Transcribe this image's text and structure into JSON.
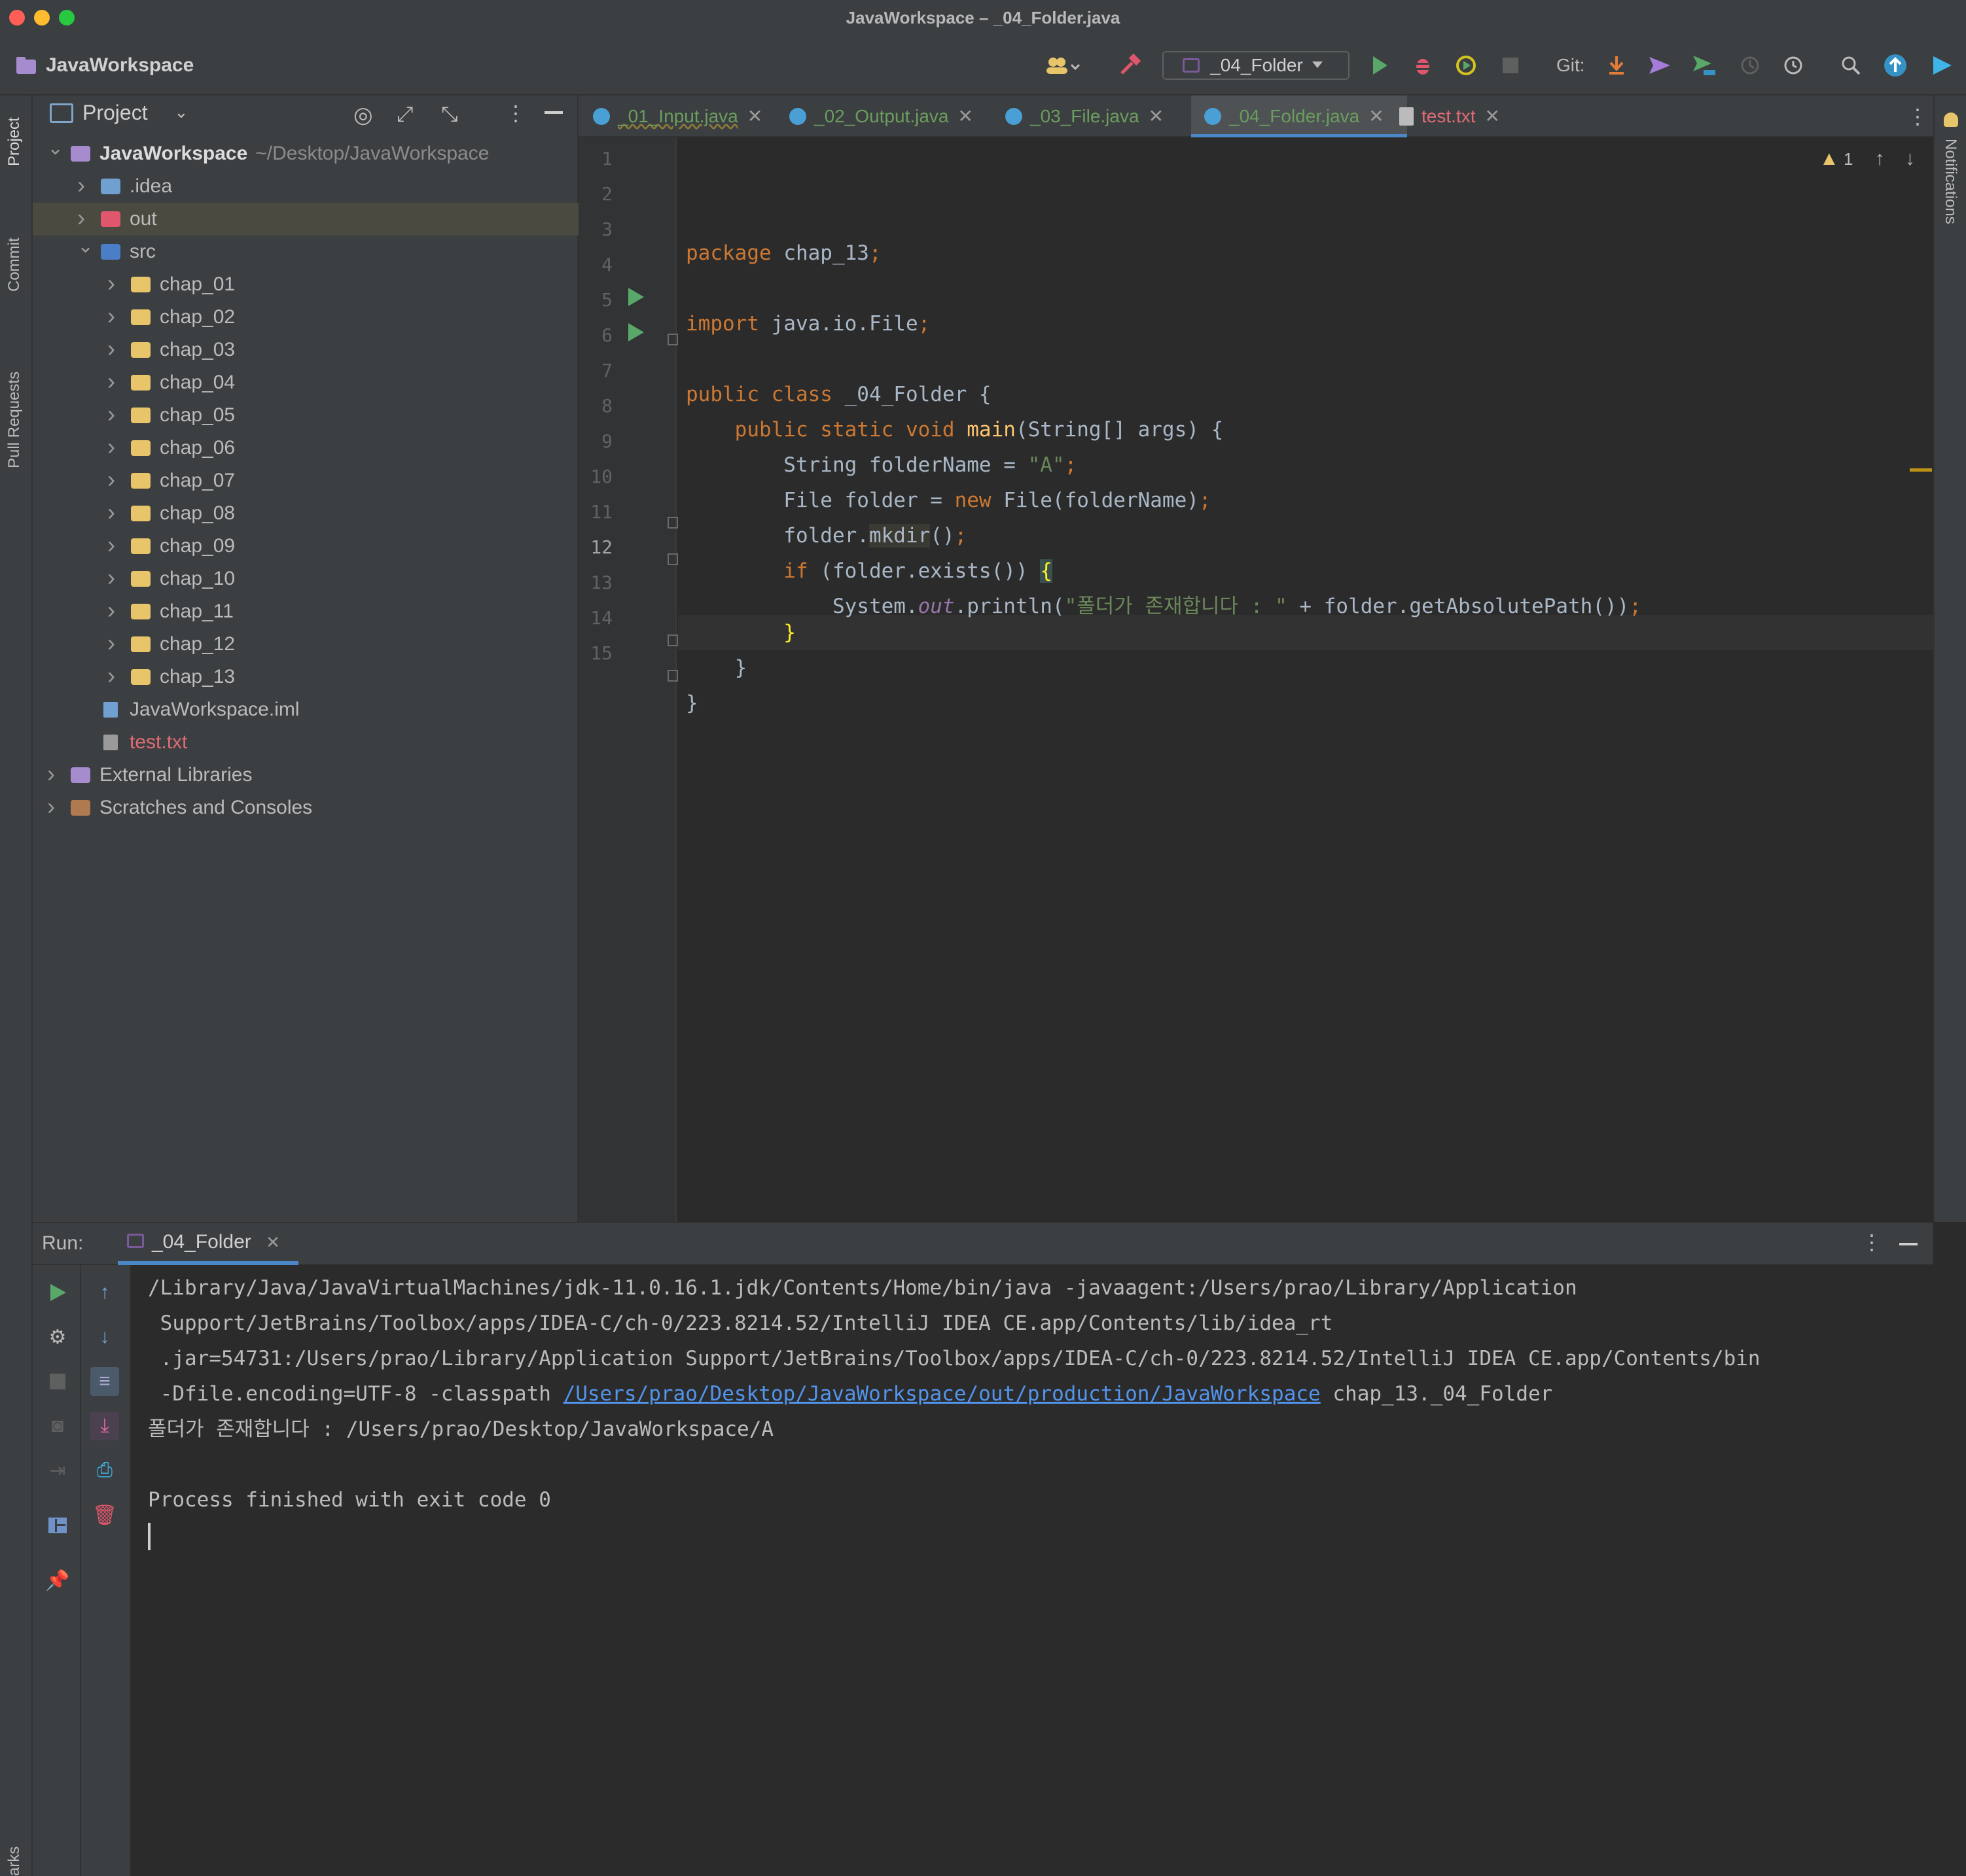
{
  "window": {
    "title": "JavaWorkspace – _04_Folder.java"
  },
  "toolbar": {
    "project_name": "JavaWorkspace",
    "run_config": "_04_Folder",
    "git_label": "Git:"
  },
  "left_strip": {
    "project": "Project",
    "commit": "Commit",
    "pull_requests": "Pull Requests",
    "bookmarks": "arks"
  },
  "right_strip": {
    "notifications": "Notifications"
  },
  "project_panel": {
    "view_label": "Project",
    "tree": [
      {
        "label": "JavaWorkspace",
        "hint": "~/Desktop/JavaWorkspace",
        "depth": 0,
        "expanded": true,
        "icon": "module-folder-icon",
        "bold": true
      },
      {
        "label": ".idea",
        "depth": 1,
        "expanded": false,
        "icon": "idea-folder-icon"
      },
      {
        "label": "out",
        "depth": 1,
        "expanded": false,
        "icon": "excluded-folder-icon",
        "selected": true
      },
      {
        "label": "src",
        "depth": 1,
        "expanded": true,
        "icon": "source-folder-icon"
      },
      {
        "label": "chap_01",
        "depth": 2,
        "expanded": false,
        "icon": "folder-icon"
      },
      {
        "label": "chap_02",
        "depth": 2,
        "expanded": false,
        "icon": "folder-icon"
      },
      {
        "label": "chap_03",
        "depth": 2,
        "expanded": false,
        "icon": "folder-icon"
      },
      {
        "label": "chap_04",
        "depth": 2,
        "expanded": false,
        "icon": "folder-icon"
      },
      {
        "label": "chap_05",
        "depth": 2,
        "expanded": false,
        "icon": "folder-icon"
      },
      {
        "label": "chap_06",
        "depth": 2,
        "expanded": false,
        "icon": "folder-icon"
      },
      {
        "label": "chap_07",
        "depth": 2,
        "expanded": false,
        "icon": "folder-icon"
      },
      {
        "label": "chap_08",
        "depth": 2,
        "expanded": false,
        "icon": "folder-icon"
      },
      {
        "label": "chap_09",
        "depth": 2,
        "expanded": false,
        "icon": "folder-icon"
      },
      {
        "label": "chap_10",
        "depth": 2,
        "expanded": false,
        "icon": "folder-icon"
      },
      {
        "label": "chap_11",
        "depth": 2,
        "expanded": false,
        "icon": "folder-icon"
      },
      {
        "label": "chap_12",
        "depth": 2,
        "expanded": false,
        "icon": "folder-icon"
      },
      {
        "label": "chap_13",
        "depth": 2,
        "expanded": false,
        "icon": "folder-icon"
      },
      {
        "label": "JavaWorkspace.iml",
        "depth": 1,
        "icon": "iml-file-icon"
      },
      {
        "label": "test.txt",
        "depth": 1,
        "icon": "text-file-icon",
        "color": "#e06c75"
      },
      {
        "label": "External Libraries",
        "depth": 0,
        "expanded": false,
        "icon": "library-icon"
      },
      {
        "label": "Scratches and Consoles",
        "depth": 0,
        "expanded": false,
        "icon": "scratches-icon"
      }
    ]
  },
  "editor": {
    "tabs": [
      {
        "label": "_01_Input.java",
        "active": false
      },
      {
        "label": "_02_Output.java",
        "active": false
      },
      {
        "label": "_03_File.java",
        "active": false
      },
      {
        "label": "_04_Folder.java",
        "active": true
      },
      {
        "label": "test.txt",
        "active": false,
        "text_file": true
      }
    ],
    "warning_count": "1",
    "line_numbers": [
      "1",
      "2",
      "3",
      "4",
      "5",
      "6",
      "7",
      "8",
      "9",
      "10",
      "11",
      "12",
      "13",
      "14",
      "15"
    ],
    "current_line": 12,
    "code": {
      "l1_kw": "package",
      "l1_rest": " chap_13",
      "l1_semi": ";",
      "l3_kw": "import",
      "l3_rest": " java.io.File",
      "l3_semi": ";",
      "l5_kw": "public class",
      "l5_rest": " _04_Folder {",
      "l6_kw": "    public static void",
      "l6_fn": " main",
      "l6_rest": "(String[] args) {",
      "l7_a": "        String folderName = ",
      "l7_str": "\"A\"",
      "l7_semi": ";",
      "l8_a": "        File folder = ",
      "l8_kw": "new",
      "l8_b": " File(folderName)",
      "l8_semi": ";",
      "l9_a": "        folder.",
      "l9_m": "mkdir",
      "l9_b": "()",
      "l9_semi": ";",
      "l10_kw": "        if",
      "l10_a": " (folder.exists()) ",
      "l10_brace": "{",
      "l11_a": "            System.",
      "l11_st": "out",
      "l11_b": ".println(",
      "l11_str": "\"폴더가 존재합니다 : \"",
      "l11_c": " + folder.getAbsolutePath())",
      "l11_semi": ";",
      "l12": "        }",
      "l13": "    }",
      "l14": "}"
    }
  },
  "run": {
    "label": "Run:",
    "tab": "_04_Folder",
    "console": {
      "line1": "/Library/Java/JavaVirtualMachines/jdk-11.0.16.1.jdk/Contents/Home/bin/java -javaagent:/Users/prao/Library/Application",
      "line2": " Support/JetBrains/Toolbox/apps/IDEA-C/ch-0/223.8214.52/IntelliJ IDEA CE.app/Contents/lib/idea_rt",
      "line3": " .jar=54731:/Users/prao/Library/Application Support/JetBrains/Toolbox/apps/IDEA-C/ch-0/223.8214.52/IntelliJ IDEA CE.app/Contents/bin",
      "line4_a": " -Dfile.encoding=UTF-8 -classpath ",
      "line4_link": "/Users/prao/Desktop/JavaWorkspace/out/production/JavaWorkspace",
      "line4_b": " chap_13._04_Folder",
      "line5": "폴더가 존재합니다 : /Users/prao/Desktop/JavaWorkspace/A",
      "line7": "Process finished with exit code 0"
    }
  },
  "colors": {
    "keyword": "#cc7832",
    "string": "#6a8759",
    "method": "#ffc66d",
    "static_field": "#9876aa",
    "link": "#5394ec",
    "run_green": "#59a869"
  }
}
